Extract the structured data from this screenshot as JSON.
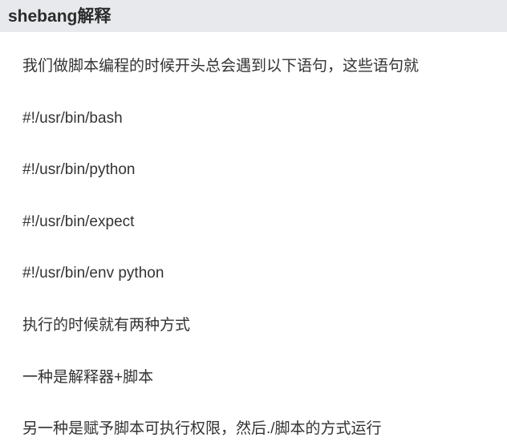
{
  "heading": "shebang解释",
  "paragraphs": [
    "我们做脚本编程的时候开头总会遇到以下语句，这些语句就",
    "#!/usr/bin/bash",
    "#!/usr/bin/python",
    "#!/usr/bin/expect",
    "#!/usr/bin/env python",
    "执行的时候就有两种方式",
    "一种是解释器+脚本",
    "另一种是赋予脚本可执行权限，然后./脚本的方式运行"
  ]
}
